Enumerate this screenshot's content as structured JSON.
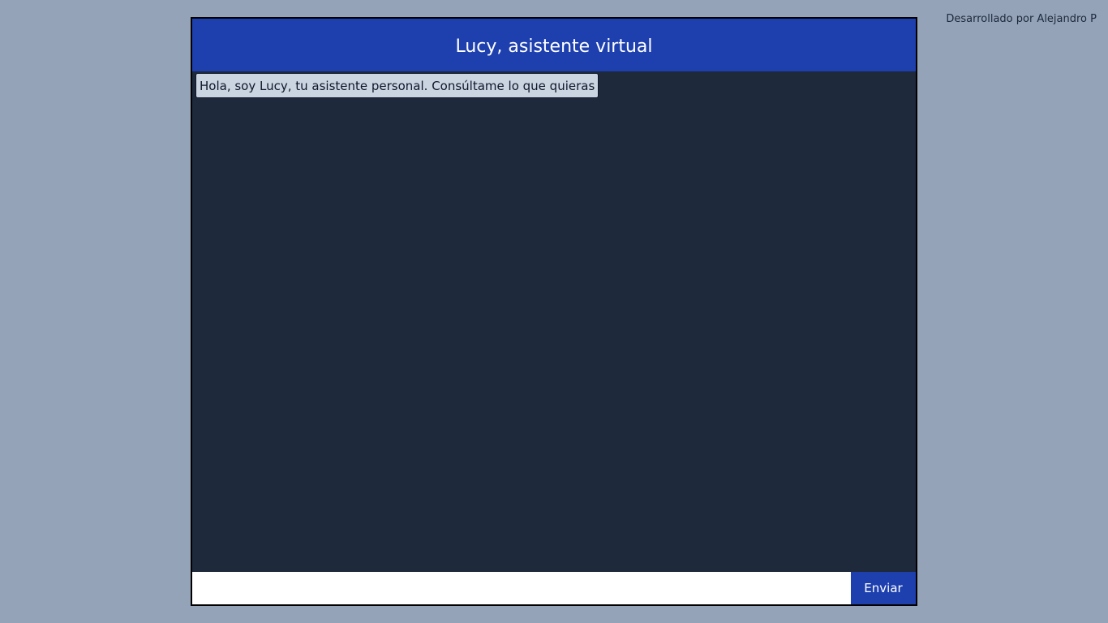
{
  "credit": {
    "text": "Desarrollado por Alejandro P"
  },
  "chat": {
    "title": "Lucy, asistente virtual",
    "messages": [
      {
        "text": "Hola, soy Lucy, tu asistente personal. Consúltame lo que quieras"
      }
    ],
    "input": {
      "value": "",
      "placeholder": ""
    },
    "send_label": "Enviar"
  },
  "colors": {
    "page_background": "#94a3b8",
    "header_background": "#1e40af",
    "chat_background": "#1e293b",
    "message_background": "#cbd5e1",
    "button_background": "#1e40af"
  }
}
